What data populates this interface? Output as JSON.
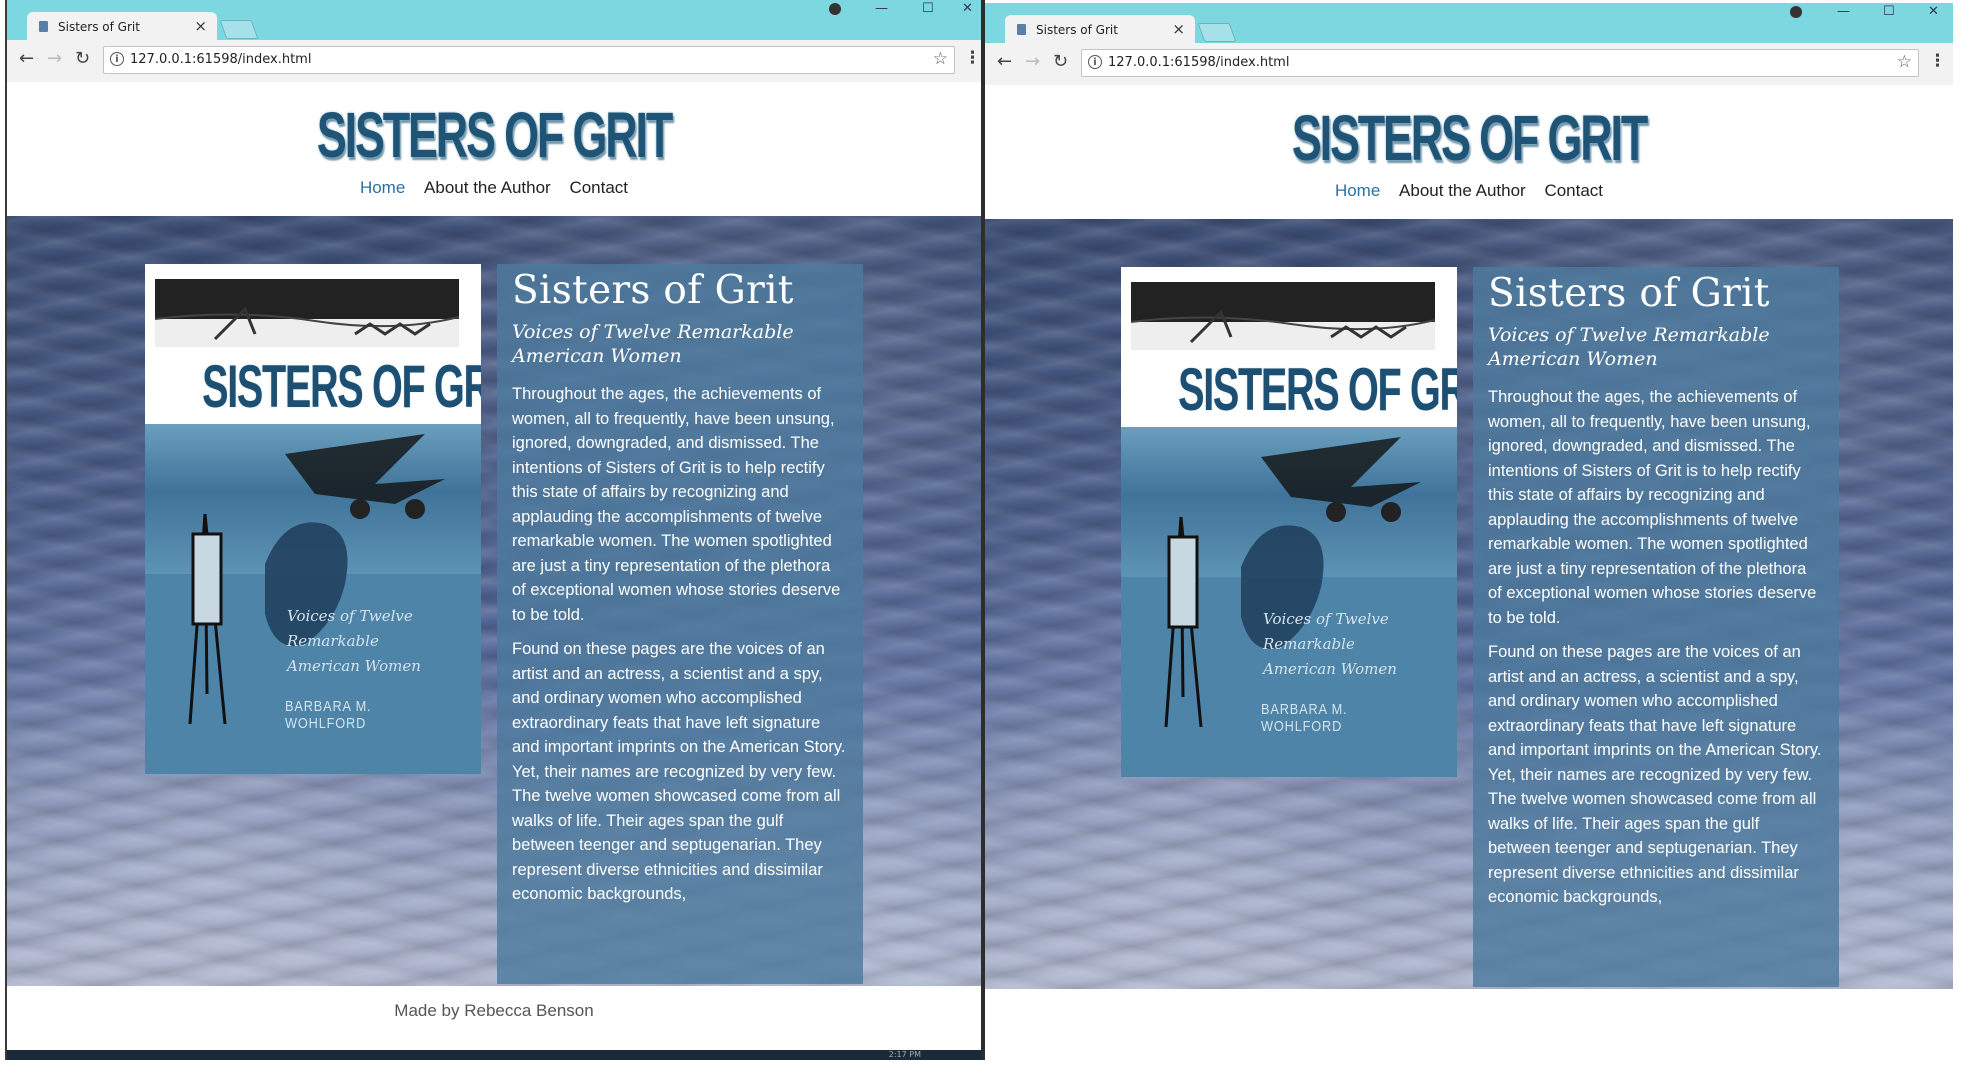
{
  "browser": {
    "tab_title": "Sisters of Grit",
    "tab_close": "×",
    "url": "127.0.0.1:61598/index.html",
    "back": "←",
    "forward": "→",
    "reload": "↻",
    "info": "i",
    "star": "☆",
    "menu": "⋮",
    "minimize": "—",
    "maximize": "☐",
    "close": "✕"
  },
  "site": {
    "logo": "SISTERS OF GRIT",
    "nav": [
      "Home",
      "About the Author",
      "Contact"
    ],
    "active_nav": "Home",
    "footer": "Made by Rebecca Benson"
  },
  "cover": {
    "title": "SISTERS OF GRIT",
    "subtitle_lines": [
      "Voices of Twelve",
      "Remarkable",
      "American Women"
    ],
    "author": "BARBARA M. WOHLFORD"
  },
  "book": {
    "title": "Sisters of Grit",
    "subtitle": "Voices of Twelve Remarkable American Women",
    "paragraphs": [
      "Throughout the ages, the achievements of women, all to frequently, have been unsung, ignored, downgraded, and dismissed. The intentions of Sisters of Grit is to help rectify this state of affairs by recognizing and applauding the accomplishments of twelve remarkable women. The women spotlighted are just a tiny representation of the plethora of exceptional women whose stories deserve to be told.",
      "Found on these pages are the voices of an artist and an actress, a scientist and a spy, and ordinary women who accomplished extraordinary feats that have left signature and important imprints on the American Story. Yet, their names are recognized by very few. The twelve women showcased come from all walks of life. Their ages span the gulf between teenger and septugenarian. They represent diverse ethnicities and dissimilar economic backgrounds,"
    ]
  },
  "colors": {
    "chrome": "#7dd7e0",
    "nav_active": "#2c6fa0",
    "logo": "#1f5476",
    "panel": "#4d7a9e"
  },
  "taskbar": {
    "clock": "2:17 PM"
  }
}
